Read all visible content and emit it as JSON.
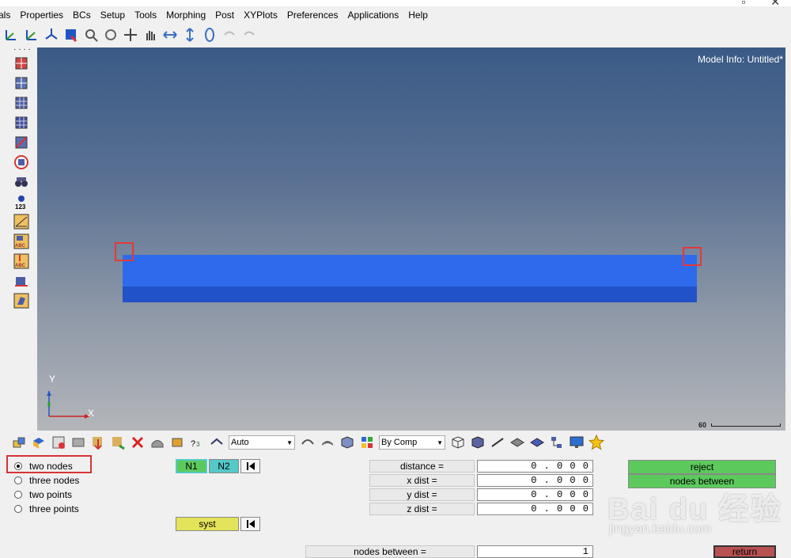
{
  "menu": [
    "als",
    "Properties",
    "BCs",
    "Setup",
    "Tools",
    "Morphing",
    "Post",
    "XYPlots",
    "Preferences",
    "Applications",
    "Help"
  ],
  "window_controls": {
    "restore": "▫",
    "close": "✕"
  },
  "viewport": {
    "model_info": "Model Info: Untitled*",
    "axis_y": "Y",
    "axis_x": "X",
    "scale_value": "60"
  },
  "toolbar2": {
    "auto_label": "Auto",
    "bycomp_label": "By Comp"
  },
  "panel": {
    "radio_options": [
      {
        "label": "two nodes",
        "selected": true
      },
      {
        "label": "three nodes",
        "selected": false
      },
      {
        "label": "two points",
        "selected": false
      },
      {
        "label": "three points",
        "selected": false
      }
    ],
    "n1_label": "N1",
    "n2_label": "N2",
    "syst_label": "syst",
    "measures": [
      {
        "label": "distance =",
        "value": "0 . 0 0 0"
      },
      {
        "label": "x dist  =",
        "value": "0 . 0 0 0"
      },
      {
        "label": "y dist  =",
        "value": "0 . 0 0 0"
      },
      {
        "label": "z dist  =",
        "value": "0 . 0 0 0"
      }
    ],
    "reject_label": "reject",
    "nodes_between_btn_label": "nodes between",
    "nodes_between_label": "nodes between  =",
    "nodes_between_value": "1",
    "return_label": "return"
  },
  "watermark": {
    "main": "Bai du 经验",
    "sub": "jingyan.baidu.com"
  },
  "colors": {
    "accent_green": "#5cc95c",
    "n_cyan": "#55c8c8",
    "syst_yellow": "#e4e45a",
    "return_red": "#b85252",
    "beam_blue": "#2e6bec"
  }
}
